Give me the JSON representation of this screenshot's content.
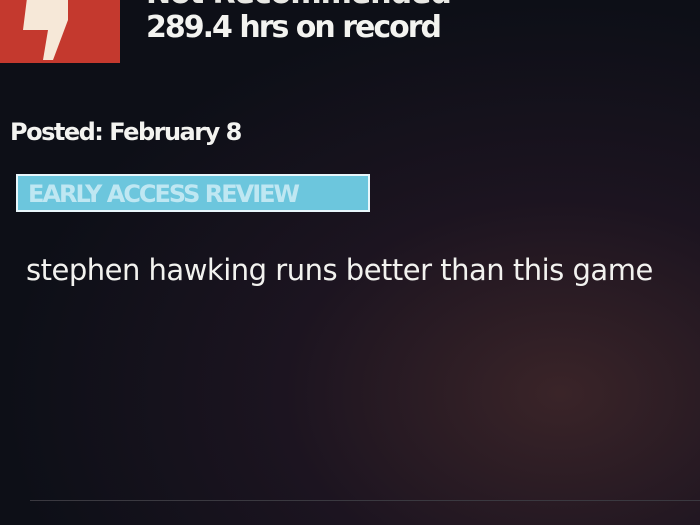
{
  "review": {
    "verdict": "Not Recommended",
    "verdict_icon": "thumbs-down-icon",
    "verdict_color": "#c4392e",
    "hours": "289.4 hrs on record",
    "posted": "Posted: February 8",
    "badge": "EARLY ACCESS REVIEW",
    "badge_color": "#6cc6dd",
    "text": "stephen hawking runs better than this game"
  }
}
